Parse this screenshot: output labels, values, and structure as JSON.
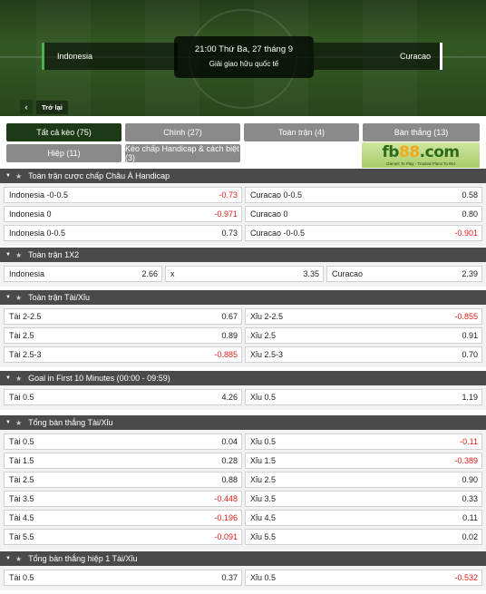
{
  "header": {
    "home_team": "Indonesia",
    "away_team": "Curacao",
    "kickoff": "21:00 Thứ Ba, 27 tháng 9",
    "league": "Giải giao hữu quốc tế",
    "back_label": "Trở lại"
  },
  "tabs": [
    {
      "label": "Tất cả kèo (75)",
      "active": true
    },
    {
      "label": "Chính (27)",
      "active": false
    },
    {
      "label": "Toàn trận (4)",
      "active": false
    },
    {
      "label": "Bàn thắng (13)",
      "active": false
    },
    {
      "label": "Hiệp (11)",
      "active": false
    },
    {
      "label": "Kèo chấp Handicap & cách biệt (3)",
      "active": false
    }
  ],
  "ad": {
    "logo_main": "fb",
    "logo_accent": "88",
    "logo_tail": ".com",
    "tagline": "Games To Play · Trusted Place To Bet"
  },
  "sections": [
    {
      "title": "Toàn trận cược chấp Châu Á Handicap",
      "columns": 2,
      "rows": [
        [
          {
            "label": "Indonesia -0-0.5",
            "odd": "-0.73"
          },
          {
            "label": "Curacao 0-0.5",
            "odd": "0.58"
          }
        ],
        [
          {
            "label": "Indonesia 0",
            "odd": "-0.971"
          },
          {
            "label": "Curacao 0",
            "odd": "0.80"
          }
        ],
        [
          {
            "label": "Indonesia 0-0.5",
            "odd": "0.73"
          },
          {
            "label": "Curacao -0-0.5",
            "odd": "-0.901"
          }
        ]
      ]
    },
    {
      "title": "Toàn trận 1X2",
      "columns": 3,
      "rows": [
        [
          {
            "label": "Indonesia",
            "odd": "2.66"
          },
          {
            "label": "x",
            "odd": "3.35"
          },
          {
            "label": "Curacao",
            "odd": "2.39"
          }
        ]
      ]
    },
    {
      "title": "Toàn trận Tài/Xỉu",
      "columns": 2,
      "rows": [
        [
          {
            "label": "Tài 2-2.5",
            "odd": "0.67"
          },
          {
            "label": "Xỉu 2-2.5",
            "odd": "-0.855"
          }
        ],
        [
          {
            "label": "Tài 2.5",
            "odd": "0.89"
          },
          {
            "label": "Xỉu 2.5",
            "odd": "0.91"
          }
        ],
        [
          {
            "label": "Tài 2.5-3",
            "odd": "-0.885"
          },
          {
            "label": "Xỉu 2.5-3",
            "odd": "0.70"
          }
        ]
      ]
    },
    {
      "title": "Goal in First 10 Minutes (00:00 - 09:59)",
      "columns": 2,
      "rows": [
        [
          {
            "label": "Tài 0.5",
            "odd": "4.26"
          },
          {
            "label": "Xỉu 0.5",
            "odd": "1.19"
          }
        ]
      ]
    },
    {
      "title": "Tổng bàn thắng Tài/Xỉu",
      "columns": 2,
      "rows": [
        [
          {
            "label": "Tài 0.5",
            "odd": "0.04"
          },
          {
            "label": "Xỉu 0.5",
            "odd": "-0.11"
          }
        ],
        [
          {
            "label": "Tài 1.5",
            "odd": "0.28"
          },
          {
            "label": "Xỉu 1.5",
            "odd": "-0.389"
          }
        ],
        [
          {
            "label": "Tài 2.5",
            "odd": "0.88"
          },
          {
            "label": "Xỉu 2.5",
            "odd": "0.90"
          }
        ],
        [
          {
            "label": "Tài 3.5",
            "odd": "-0.448"
          },
          {
            "label": "Xỉu 3.5",
            "odd": "0.33"
          }
        ],
        [
          {
            "label": "Tài 4.5",
            "odd": "-0.196"
          },
          {
            "label": "Xỉu 4.5",
            "odd": "0.11"
          }
        ],
        [
          {
            "label": "Tài 5.5",
            "odd": "-0.091"
          },
          {
            "label": "Xỉu 5.5",
            "odd": "0.02"
          }
        ]
      ]
    },
    {
      "title": "Tổng bàn thắng hiệp 1 Tài/Xỉu",
      "columns": 2,
      "rows": [
        [
          {
            "label": "Tài 0.5",
            "odd": "0.37"
          },
          {
            "label": "Xỉu 0.5",
            "odd": "-0.532"
          }
        ]
      ]
    }
  ],
  "colors": {
    "negative_odd": "#e0201a",
    "active_tab": "#1d3a16",
    "section_header": "#4a4a4a"
  }
}
